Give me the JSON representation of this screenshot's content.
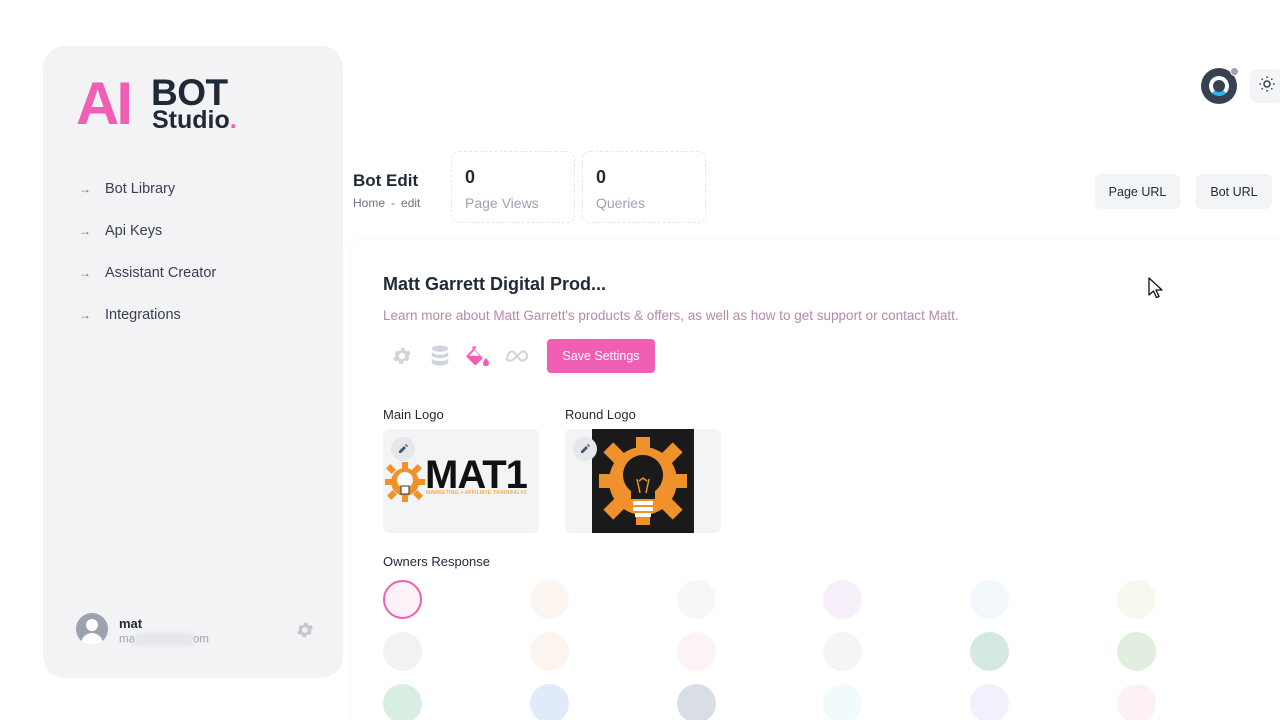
{
  "sidebar": {
    "logo": {
      "ai": "AI",
      "bot": "BOT",
      "studio": "Studio",
      "dot": "."
    },
    "items": [
      {
        "label": "Bot Library"
      },
      {
        "label": "Api Keys"
      },
      {
        "label": "Assistant Creator"
      },
      {
        "label": "Integrations"
      }
    ],
    "user": {
      "name": "mat",
      "email_prefix": "ma",
      "email_suffix": "om"
    }
  },
  "header": {
    "title": "Bot Edit",
    "breadcrumb": {
      "home": "Home",
      "sep": "-",
      "current": "edit"
    },
    "stats": [
      {
        "value": "0",
        "label": "Page Views"
      },
      {
        "value": "0",
        "label": "Queries"
      }
    ],
    "buttons": {
      "page_url": "Page URL",
      "bot_url": "Bot URL"
    }
  },
  "bot": {
    "name": "Matt Garrett Digital Prod...",
    "description": "Learn more about Matt Garrett's products & offers, as well as how to get support or contact Matt.",
    "save_label": "Save Settings",
    "toolbar_icons": [
      "gear-icon",
      "database-icon",
      "paint-bucket-icon",
      "meta-icon"
    ]
  },
  "logos": {
    "main_label": "Main Logo",
    "round_label": "Round Logo",
    "main_text": "MAT1",
    "main_tagline": "MARKETING + AFFILIATE TRAINING #1"
  },
  "owners_response": {
    "label": "Owners Response",
    "colors": [
      "#fdf2f8",
      "#fdf6f0",
      "#f7f7f8",
      "#f7f0fa",
      "#f3f8fc",
      "#f8f8ef",
      "#f1f2f4",
      "#fbf4ef",
      "#fcf3f6",
      "#f5f5f6",
      "#d5e9e3",
      "#e2eee0",
      "#d9eee2",
      "#e0eaf8",
      "#d9dde6",
      "#f2fbfc",
      "#f1f0fd",
      "#fdf1f6"
    ]
  },
  "colors": {
    "accent": "#f05fb3",
    "sidebar_bg": "#f3f3f5"
  }
}
